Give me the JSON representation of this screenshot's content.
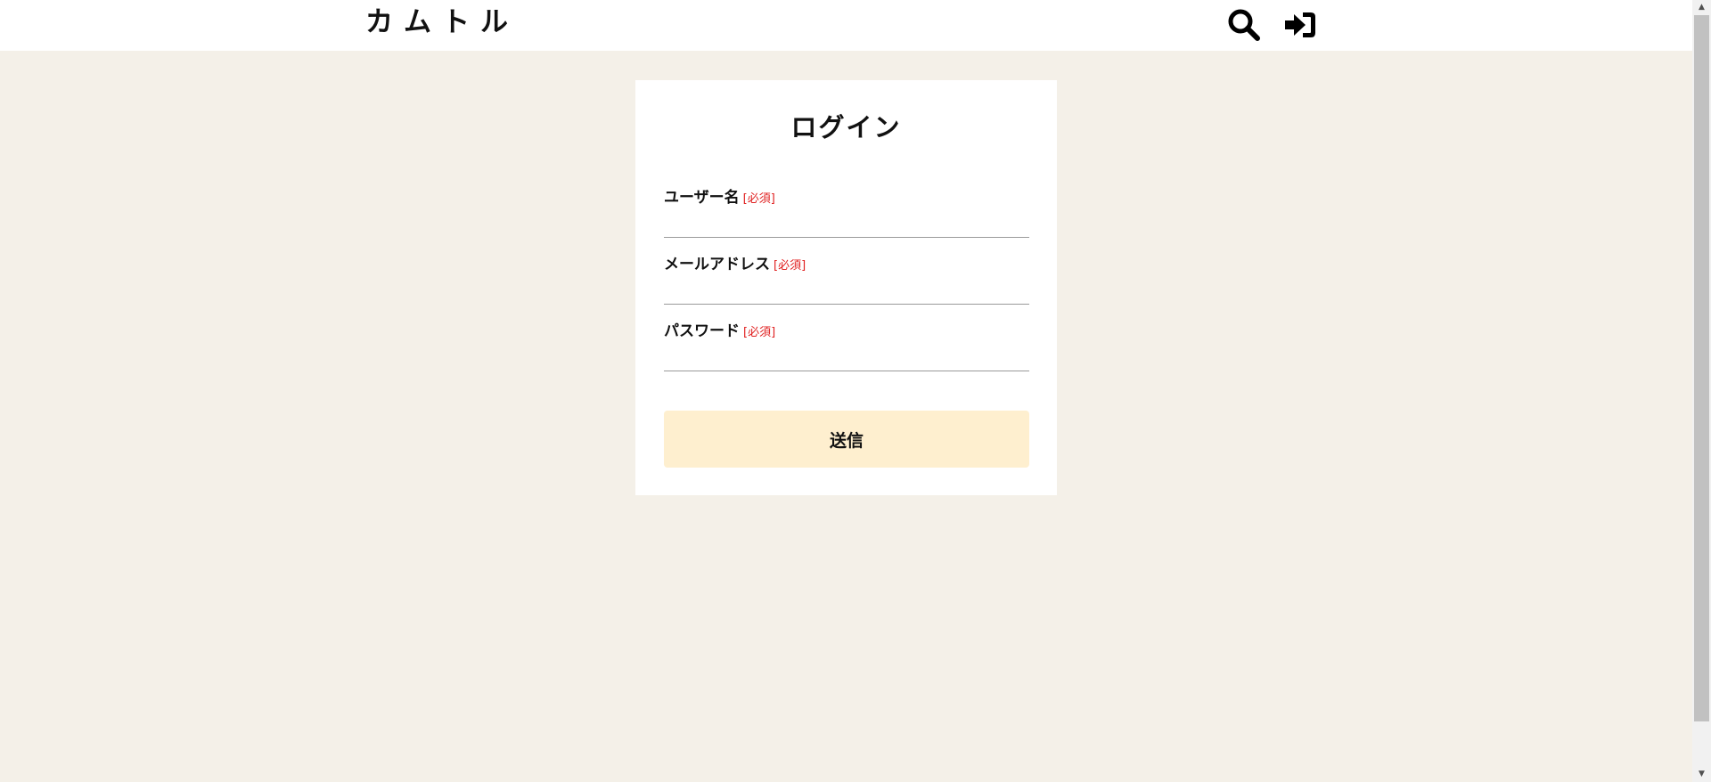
{
  "header": {
    "brand": "カムトル",
    "icons": [
      "search-icon",
      "sign-in-icon"
    ]
  },
  "login_form": {
    "title": "ログイン",
    "required_mark": "[必須]",
    "fields": [
      {
        "label": "ユーザー名",
        "value": "",
        "type": "text"
      },
      {
        "label": "メールアドレス",
        "value": "",
        "type": "email"
      },
      {
        "label": "パスワード",
        "value": "",
        "type": "password"
      }
    ],
    "submit_label": "送信"
  },
  "colors": {
    "page_background": "#f4f0e8",
    "card_background": "#ffffff",
    "submit_background": "#feefcf",
    "required_text": "#e02020"
  }
}
